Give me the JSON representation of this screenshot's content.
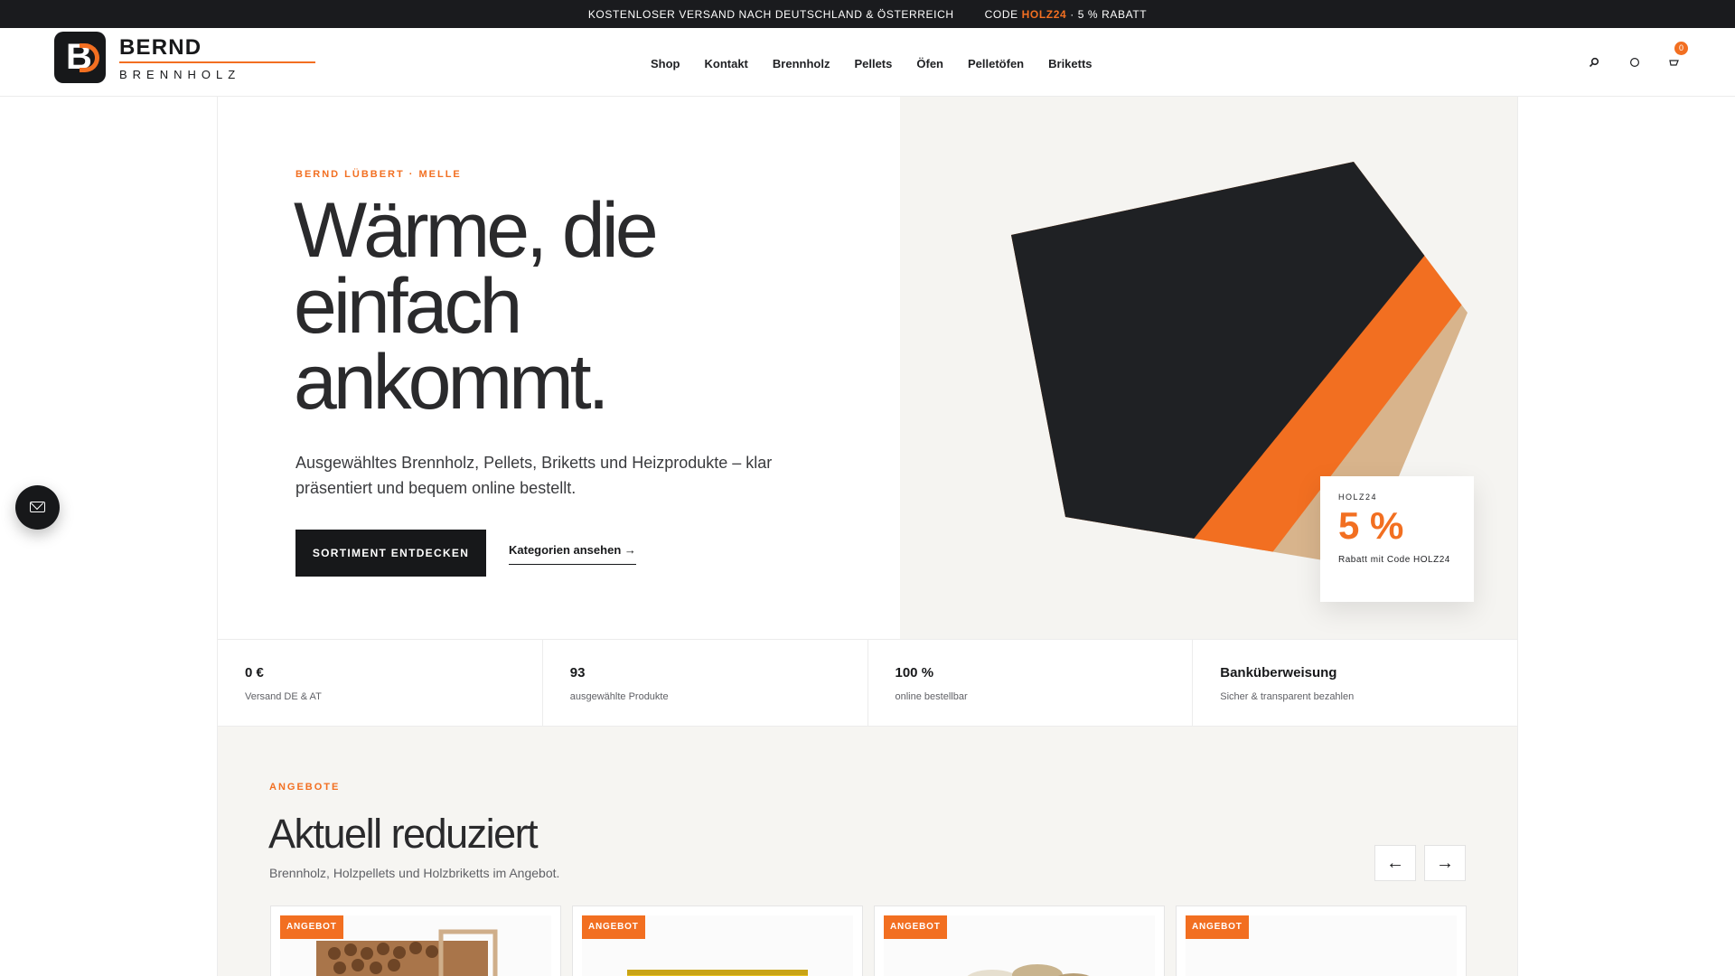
{
  "topbar": {
    "shipping": "KOSTENLOSER VERSAND NACH DEUTSCHLAND & ÖSTERREICH",
    "code_prefix": "CODE",
    "code": "HOLZ24",
    "code_suffix": "· 5 % RABATT"
  },
  "header": {
    "brand_name": "BERND",
    "brand_sub": "BRENNHOLZ",
    "logo_letter": "B",
    "nav": [
      "Shop",
      "Kontakt",
      "Brennholz",
      "Pellets",
      "Öfen",
      "Pelletöfen",
      "Briketts"
    ],
    "icons": [
      "search-icon",
      "account-icon",
      "cart-icon"
    ],
    "cart_count": "0"
  },
  "hero": {
    "eyebrow": "BERND LÜBBERT · MELLE",
    "title": "Wärme, die einfach ankommt.",
    "text": "Ausgewähltes Brennholz, Pellets, Briketts und Heizprodukte – klar präsentiert und bequem online bestellt.",
    "primary_button": "SORTIMENT ENTDECKEN",
    "secondary_link": "Kategorien ansehen →",
    "promo": {
      "code": "HOLZ24",
      "percent": "5 %",
      "desc": "Rabatt mit Code HOLZ24"
    }
  },
  "stats": [
    {
      "value": "0 €",
      "label": "Versand DE & AT"
    },
    {
      "value": "93",
      "label": "ausgewählte Produkte"
    },
    {
      "value": "100 %",
      "label": "online bestellbar"
    },
    {
      "value": "Banküberweisung",
      "label": "Sicher & transparent bezahlen"
    }
  ],
  "offers": {
    "eyebrow": "ANGEBOTE",
    "title": "Aktuell reduziert",
    "subtitle": "Brennholz, Holzpellets und Holzbriketts im Angebot.",
    "prev": "←",
    "next": "→",
    "badge": "ANGEBOT",
    "cards": [
      {
        "badge": "ANGEBOT"
      },
      {
        "badge": "ANGEBOT"
      },
      {
        "badge": "ANGEBOT"
      },
      {
        "badge": "ANGEBOT"
      }
    ]
  },
  "colors": {
    "accent": "#f26f21",
    "dark": "#17181a",
    "tan": "#d8b48c",
    "hero_bg": "#f5f4f1"
  }
}
